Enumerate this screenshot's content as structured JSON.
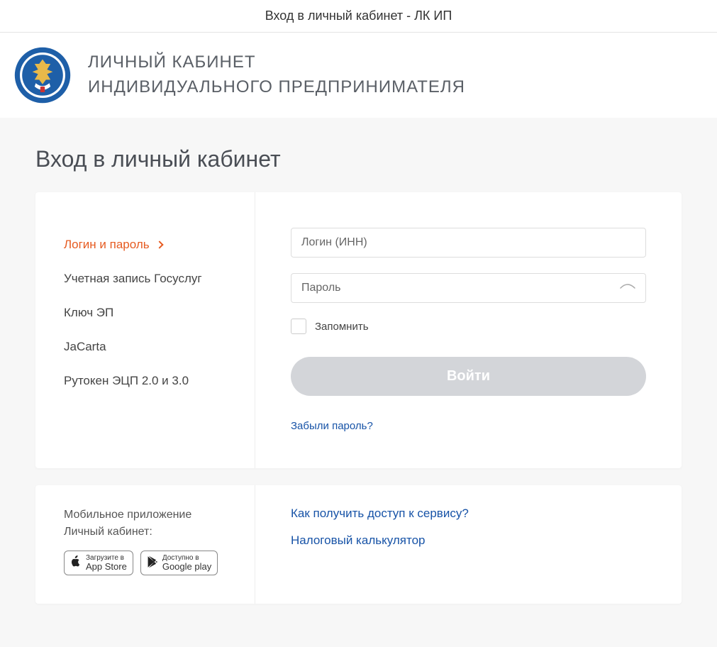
{
  "titlebar": "Вход в личный кабинет - ЛК ИП",
  "header": {
    "line1": "ЛИЧНЫЙ КАБИНЕТ",
    "line2": "ИНДИВИДУАЛЬНОГО ПРЕДПРИНИМАТЕЛЯ"
  },
  "page_title": "Вход в личный кабинет",
  "methods": [
    "Логин и пароль",
    "Учетная запись Госуслуг",
    "Ключ ЭП",
    "JaCarta",
    "Рутокен ЭЦП 2.0 и 3.0"
  ],
  "form": {
    "login_placeholder": "Логин (ИНН)",
    "password_placeholder": "Пароль",
    "remember_label": "Запомнить",
    "submit_label": "Войти",
    "forgot_label": "Забыли пароль?"
  },
  "mobile": {
    "title_l1": "Мобильное приложение",
    "title_l2": "Личный кабинет:",
    "appstore_top": "Загрузите в",
    "appstore_bottom": "App Store",
    "gplay_top": "Доступно в",
    "gplay_bottom": "Google play"
  },
  "help": {
    "link1": "Как получить доступ к сервису?",
    "link2": "Налоговый калькулятор"
  }
}
